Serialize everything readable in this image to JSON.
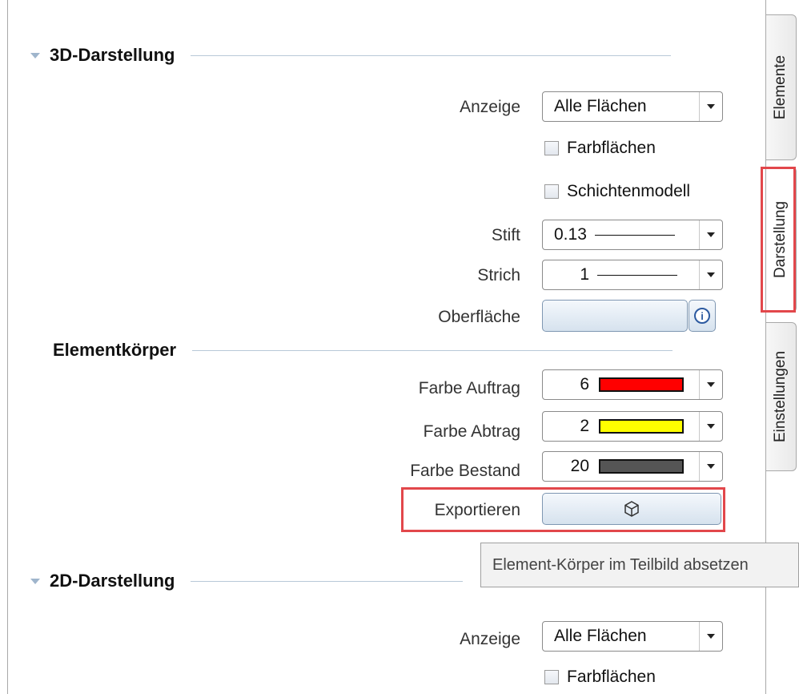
{
  "sections": {
    "d3": {
      "title": "3D-Darstellung"
    },
    "koerper": {
      "title": "Elementkörper"
    },
    "d2": {
      "title": "2D-Darstellung"
    }
  },
  "d3": {
    "anzeige_label": "Anzeige",
    "anzeige_value": "Alle Flächen",
    "farbflaechen_label": "Farbflächen",
    "schichten_label": "Schichtenmodell",
    "stift_label": "Stift",
    "stift_value": "0.13",
    "strich_label": "Strich",
    "strich_value": "1",
    "oberflaeche_label": "Oberfläche"
  },
  "koerper": {
    "auftrag_label": "Farbe Auftrag",
    "auftrag_value": "6",
    "auftrag_color": "#ff0000",
    "abtrag_label": "Farbe Abtrag",
    "abtrag_value": "2",
    "abtrag_color": "#ffff00",
    "bestand_label": "Farbe Bestand",
    "bestand_value": "20",
    "bestand_color": "#555555",
    "export_label": "Exportieren",
    "export_icon": "cube-icon"
  },
  "tooltip": "Element-Körper im Teilbild absetzen",
  "d2": {
    "anzeige_label": "Anzeige",
    "anzeige_value": "Alle Flächen",
    "farbflaechen_label": "Farbflächen"
  },
  "tabs": [
    {
      "label": "Elemente",
      "active": false
    },
    {
      "label": "Darstellung",
      "active": true
    },
    {
      "label": "Einstellungen",
      "active": false
    }
  ],
  "highlight_color": "#e2474b"
}
